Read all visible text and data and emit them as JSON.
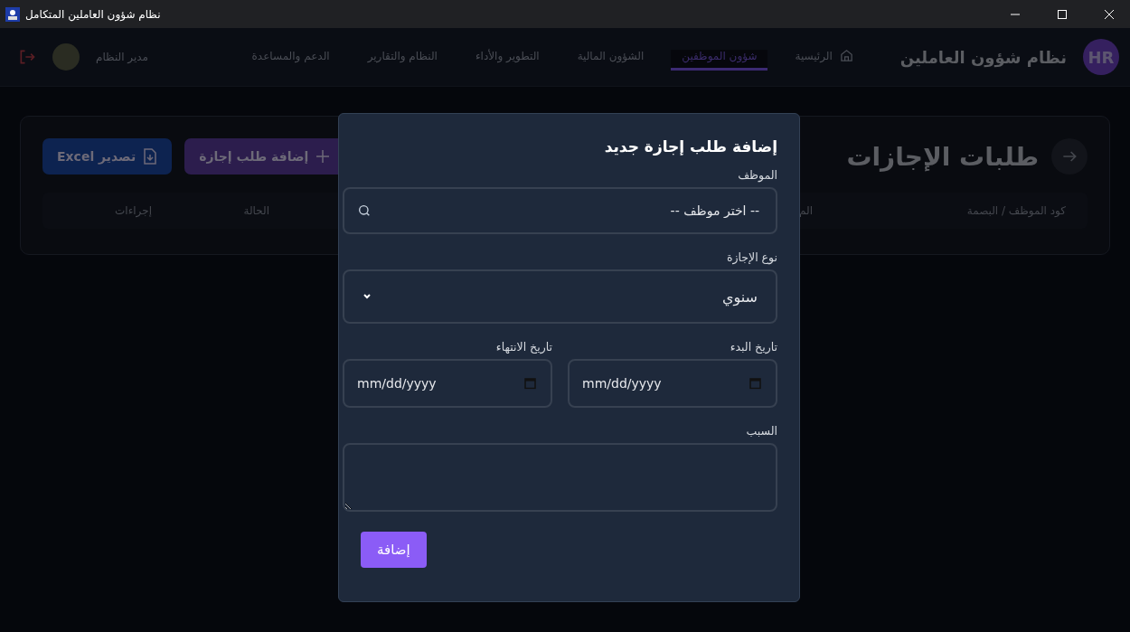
{
  "window": {
    "title": "نظام شؤون العاملين المتكامل"
  },
  "header": {
    "logo": "HR",
    "title": "نظام شؤون العاملين",
    "nav": [
      {
        "label": "الرئيسية",
        "selected": false,
        "kind": "home"
      },
      {
        "label": "شؤون الموظفين",
        "selected": true,
        "kind": "tab"
      },
      {
        "label": "الشؤون المالية",
        "selected": false,
        "kind": "tab"
      },
      {
        "label": "التطوير والأداء",
        "selected": false,
        "kind": "tab"
      },
      {
        "label": "النظام والتقارير",
        "selected": false,
        "kind": "tab"
      },
      {
        "label": "الدعم والمساعدة",
        "selected": false,
        "kind": "tab"
      }
    ],
    "user": {
      "name": "مدير النظام"
    }
  },
  "page": {
    "title": "طلبات الإجازات",
    "buttons": [
      {
        "label": "إضافة طلب إجازة",
        "kind": "add"
      },
      {
        "label": "تصدير Excel",
        "kind": "export"
      }
    ],
    "table": {
      "columns": [
        "كود الموظف / البصمة",
        "الم",
        "الحالة",
        "إجراءات"
      ]
    }
  },
  "dialog": {
    "title": "إضافة طلب إجازة جديد",
    "fields": [
      {
        "kind": "search",
        "label": "الموظف",
        "placeholder": "-- اختر موظف --"
      },
      {
        "kind": "select",
        "label": "نوع الإجازة",
        "value": "سنوي"
      },
      {
        "kind": "date",
        "label": "تاريخ البدء",
        "placeholder": "mm/dd/yyyy"
      },
      {
        "kind": "date",
        "label": "تاريخ الانتهاء",
        "placeholder": "mm/dd/yyyy"
      },
      {
        "kind": "textarea",
        "label": "السبب"
      }
    ],
    "submit": "إضافة"
  }
}
